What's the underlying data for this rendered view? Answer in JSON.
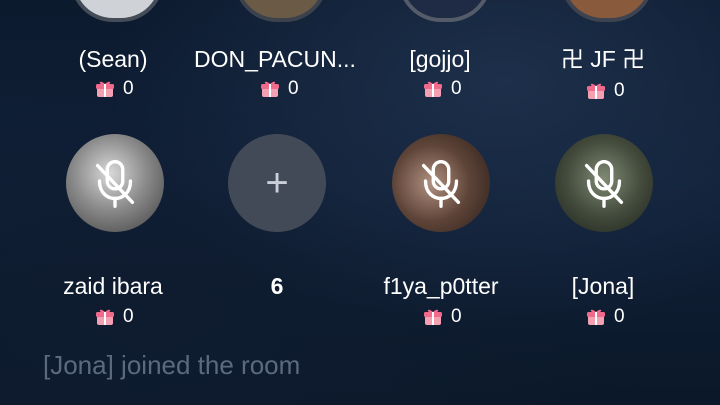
{
  "row1": [
    {
      "name": "(Sean)",
      "gifts": "0"
    },
    {
      "name": "DON_PACUN...",
      "gifts": "0"
    },
    {
      "name": "[gojjo]",
      "gifts": "0"
    },
    {
      "name": "卍 JF 卍",
      "gifts": "0"
    }
  ],
  "row2": [
    {
      "name": "zaid ibara",
      "gifts": "0",
      "muted": true
    },
    {
      "name": "6",
      "gifts": "",
      "empty": true
    },
    {
      "name": "f1ya_p0tter",
      "gifts": "0",
      "muted": true
    },
    {
      "name": "[Jona]",
      "gifts": "0",
      "muted": true
    }
  ],
  "toast": "[Jona] joined the room",
  "colors": {
    "gift_pink": "#f06a8c",
    "empty_slot": "#434a57",
    "toast": "#5c6a80"
  },
  "icons": {
    "gift": "gift-icon",
    "mute": "mic-off-icon",
    "add": "plus-icon"
  }
}
